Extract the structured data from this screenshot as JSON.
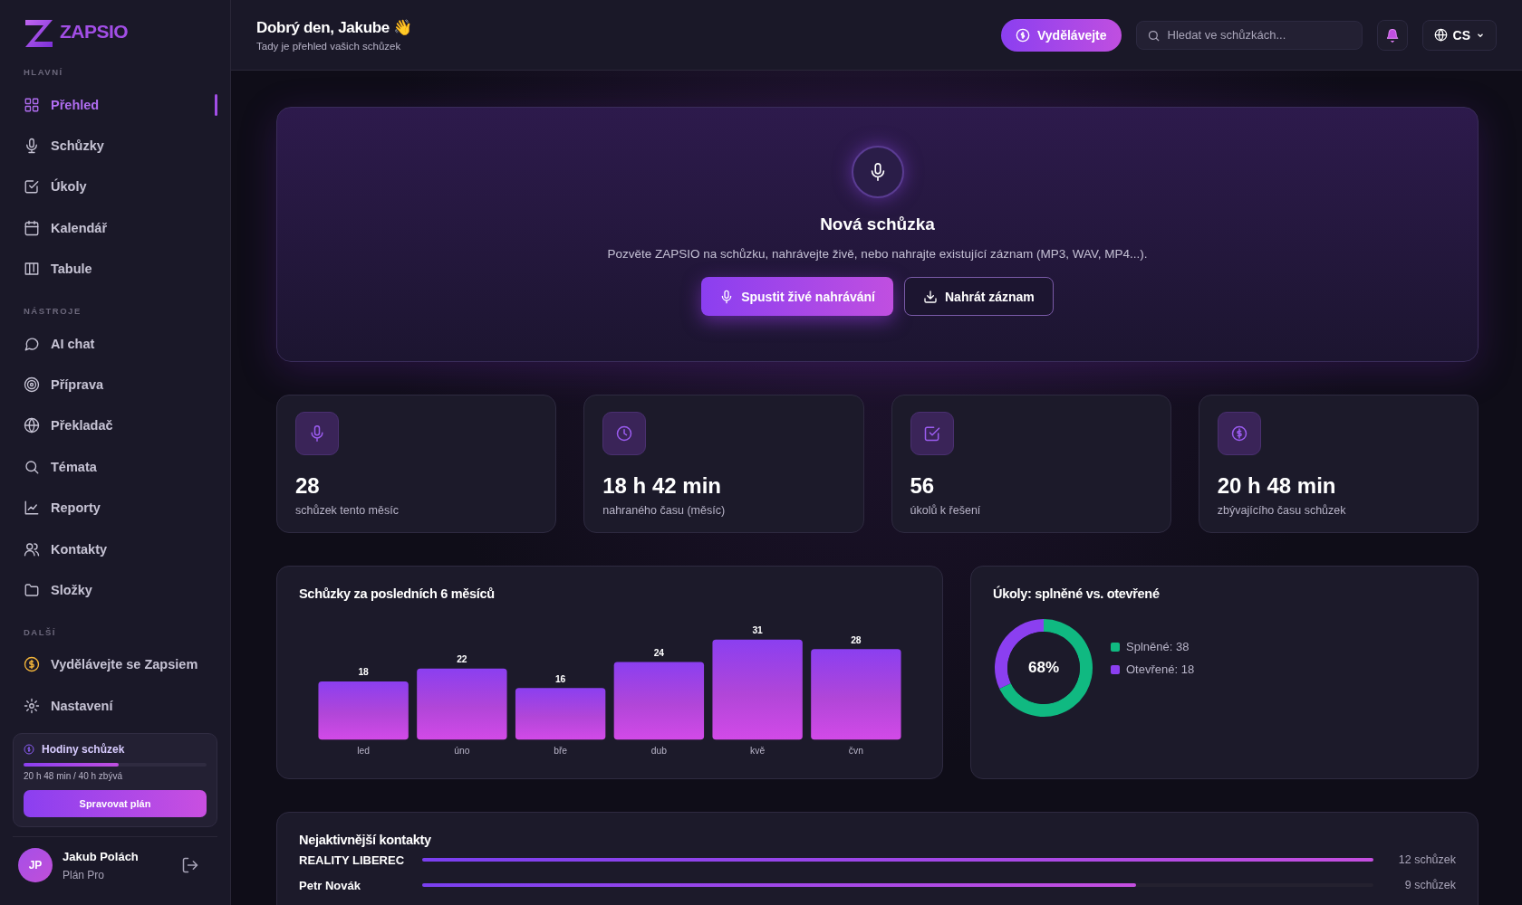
{
  "sidebar": {
    "logo": "ZAPSIO",
    "sections": [
      {
        "title": "HLAVNÍ",
        "items": [
          {
            "label": "Přehled",
            "selected": true
          },
          {
            "label": "Schůzky",
            "selected": false
          },
          {
            "label": "Úkoly",
            "selected": false
          },
          {
            "label": "Kalendář",
            "selected": false
          },
          {
            "label": "Tabule",
            "selected": false
          }
        ]
      },
      {
        "title": "NÁSTROJE",
        "items": [
          {
            "label": "AI chat",
            "selected": false
          },
          {
            "label": "Příprava",
            "selected": false
          },
          {
            "label": "Překladač",
            "selected": false
          },
          {
            "label": "Témata",
            "selected": false
          },
          {
            "label": "Reporty",
            "selected": false
          },
          {
            "label": "Kontakty",
            "selected": false
          },
          {
            "label": "Složky",
            "selected": false
          }
        ]
      },
      {
        "title": "DALŠÍ",
        "items": [
          {
            "label": "Vydělávejte se Zapsiem",
            "selected": false
          },
          {
            "label": "Nastavení",
            "selected": false
          }
        ]
      }
    ],
    "plan": {
      "title": "Hodiny schůzek",
      "level": 0.52,
      "reading": "20 h 48 min / 40 h zbývá",
      "button": "Spravovat plán"
    },
    "user": {
      "initials": "JP",
      "name": "Jakub Polách",
      "plan": "Plán Pro"
    }
  },
  "header": {
    "greeting": "Dobrý den, Jakube 👋",
    "subtitle": "Tady je přehled vašich schůzek",
    "earn_button": "Vydělávejte",
    "search": {
      "placeholder": "Hledat ve schůzkách..."
    },
    "language": "CS"
  },
  "hero": {
    "title": "Nová schůzka",
    "text": "Pozvěte ZAPSIO na schůzku, nahrávejte živě, nebo nahrajte existující záznam (MP3, WAV, MP4...).",
    "buttons": [
      {
        "label": "Spustit živé nahrávání",
        "kind": "primary"
      },
      {
        "label": "Nahrát záznam",
        "kind": "outline"
      }
    ]
  },
  "stats": [
    {
      "value": "28",
      "label": "schůzek tento měsíc"
    },
    {
      "value": "18 h 42 min",
      "label": "nahraného času (měsíc)"
    },
    {
      "value": "56",
      "label": "úkolů k řešení"
    },
    {
      "value": "20 h 48 min",
      "label": "zbývajícího času schůzek"
    }
  ],
  "meetings_chart": {
    "title": "Schůzky za posledních 6 měsíců",
    "chart_data": {
      "type": "bar",
      "categories": [
        "led",
        "úno",
        "bře",
        "dub",
        "kvě",
        "čvn"
      ],
      "values": [
        18,
        22,
        16,
        24,
        31,
        28
      ],
      "data_labels": true
    }
  },
  "tasks_chart": {
    "title": "Úkoly: splněné vs. otevřené",
    "center": "68%",
    "chart_data": {
      "type": "donut",
      "values": [
        68,
        32
      ]
    },
    "legend": [
      {
        "label": "Splněné: 38",
        "color": "#10b981"
      },
      {
        "label": "Otevřené: 18",
        "color": "#8b3ff0"
      }
    ]
  },
  "contacts": {
    "title": "Nejaktivnější kontakty",
    "rows": [
      {
        "name": "REALITY LIBEREC",
        "level": 1,
        "count": "12 schůzek"
      },
      {
        "name": "Petr Novák",
        "level": 0.75,
        "count": "9 schůzek"
      }
    ]
  }
}
